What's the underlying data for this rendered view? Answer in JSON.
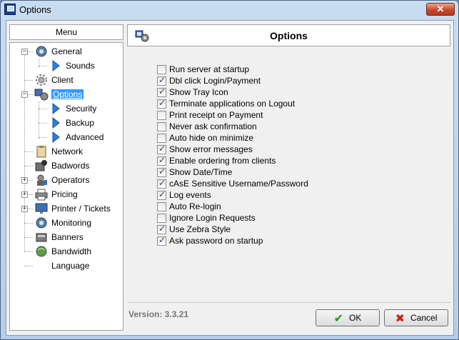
{
  "window": {
    "title": "Options",
    "close_glyph": "✕"
  },
  "menu": {
    "header": "Menu"
  },
  "tree": [
    {
      "label": "General",
      "icon": "globe-gear-icon",
      "expander": "−",
      "selected": false
    },
    {
      "label": "Sounds",
      "icon": "arrow-icon",
      "selected": false
    },
    {
      "label": "Client",
      "icon": "gear-icon",
      "selected": false
    },
    {
      "label": "Options",
      "icon": "options-icon",
      "expander": "−",
      "selected": true
    },
    {
      "label": "Security",
      "icon": "arrow-icon",
      "selected": false
    },
    {
      "label": "Backup",
      "icon": "arrow-icon",
      "selected": false
    },
    {
      "label": "Advanced",
      "icon": "arrow-icon",
      "selected": false
    },
    {
      "label": "Network",
      "icon": "clipboard-icon",
      "selected": false
    },
    {
      "label": "Badwords",
      "icon": "badwords-icon",
      "selected": false
    },
    {
      "label": "Operators",
      "icon": "operators-icon",
      "expander": "+",
      "selected": false
    },
    {
      "label": "Pricing",
      "icon": "printer-icon",
      "expander": "+",
      "selected": false
    },
    {
      "label": "Printer / Tickets",
      "icon": "monitor-icon",
      "expander": "+",
      "selected": false
    },
    {
      "label": "Monitoring",
      "icon": "globe-gear-icon",
      "selected": false
    },
    {
      "label": "Banners",
      "icon": "banners-icon",
      "selected": false
    },
    {
      "label": "Bandwidth",
      "icon": "globe-icon",
      "selected": false
    },
    {
      "label": "Language",
      "icon": "",
      "selected": false
    }
  ],
  "panel": {
    "title": "Options"
  },
  "options": [
    {
      "label": "Run server at startup",
      "checked": false
    },
    {
      "label": "Dbl click Login/Payment",
      "checked": true
    },
    {
      "label": "Show Tray Icon",
      "checked": true
    },
    {
      "label": "Terminate applications on Logout",
      "checked": true
    },
    {
      "label": "Print receipt on Payment",
      "checked": false
    },
    {
      "label": "Never ask confirmation",
      "checked": false
    },
    {
      "label": "Auto hide on minimize",
      "checked": false
    },
    {
      "label": "Show error messages",
      "checked": true
    },
    {
      "label": "Enable ordering from clients",
      "checked": true
    },
    {
      "label": "Show Date/Time",
      "checked": true
    },
    {
      "label": "cAsE Sensitive Username/Password",
      "checked": true
    },
    {
      "label": "Log events",
      "checked": true
    },
    {
      "label": "Auto Re-login",
      "checked": false
    },
    {
      "label": "Ignore Login Requests",
      "checked": false
    },
    {
      "label": "Use Zebra Style",
      "checked": true
    },
    {
      "label": "Ask password on startup",
      "checked": true
    }
  ],
  "footer": {
    "version": "Version: 3.3.21",
    "ok_label": "OK",
    "cancel_label": "Cancel"
  }
}
